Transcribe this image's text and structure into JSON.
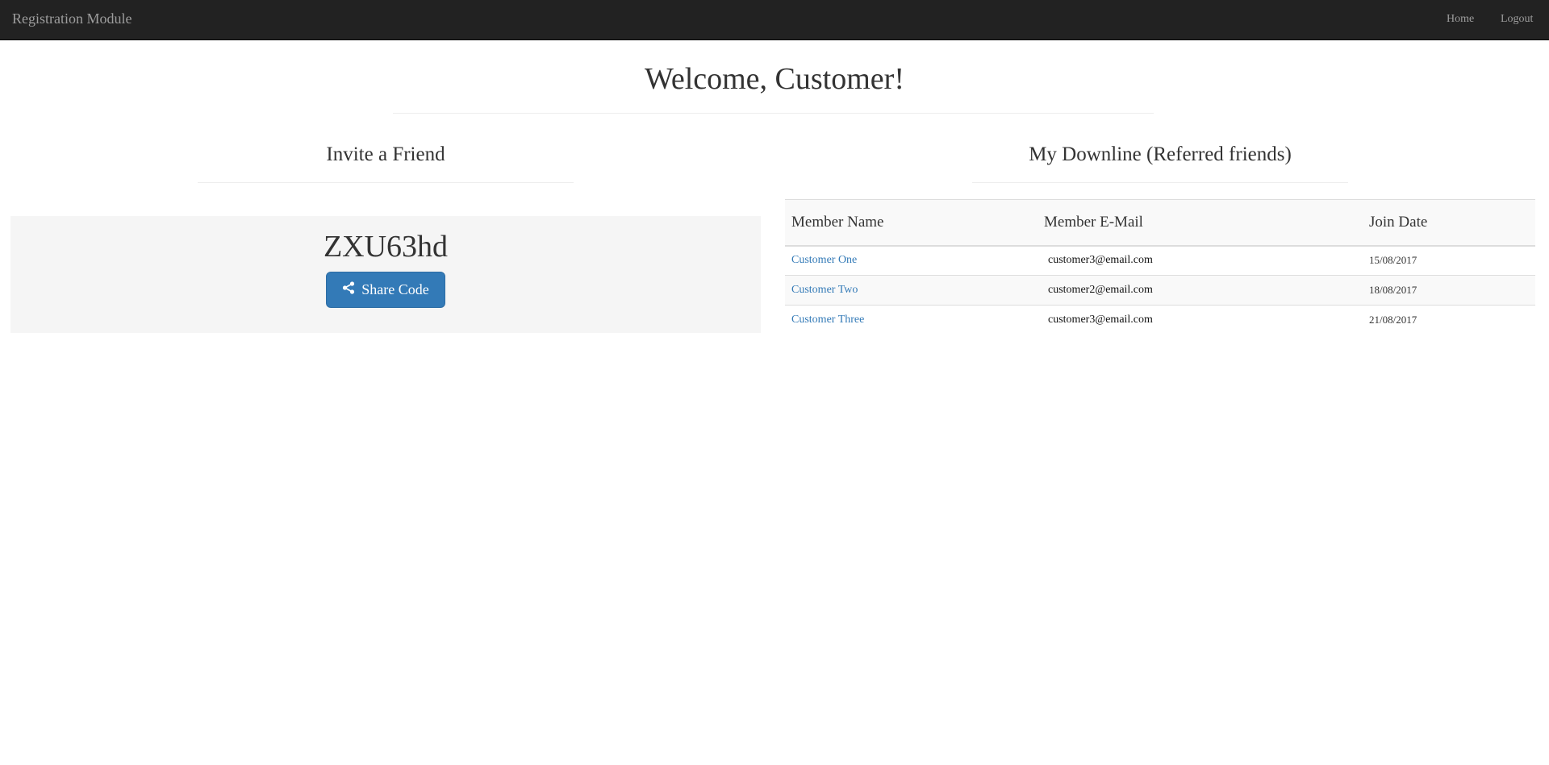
{
  "navbar": {
    "brand": "Registration Module",
    "links": [
      "Home",
      "Logout"
    ]
  },
  "page": {
    "title": "Welcome, Customer!"
  },
  "invite": {
    "heading": "Invite a Friend",
    "code": "ZXU63hd",
    "share_label": "Share Code",
    "share_icon": "share-icon"
  },
  "downline": {
    "heading": "My Downline (Referred friends)",
    "columns": [
      "Member Name",
      "Member E-Mail",
      "Join Date"
    ],
    "rows": [
      {
        "name": "Customer One",
        "email": "customer3@email.com",
        "date": "15/08/2017"
      },
      {
        "name": "Customer Two",
        "email": "customer2@email.com",
        "date": "18/08/2017"
      },
      {
        "name": "Customer Three",
        "email": "customer3@email.com",
        "date": "21/08/2017"
      }
    ]
  },
  "colors": {
    "navbar": "#222222",
    "nav_text": "#9d9d9d",
    "primary": "#337ab7",
    "panel": "#f5f5f5"
  }
}
